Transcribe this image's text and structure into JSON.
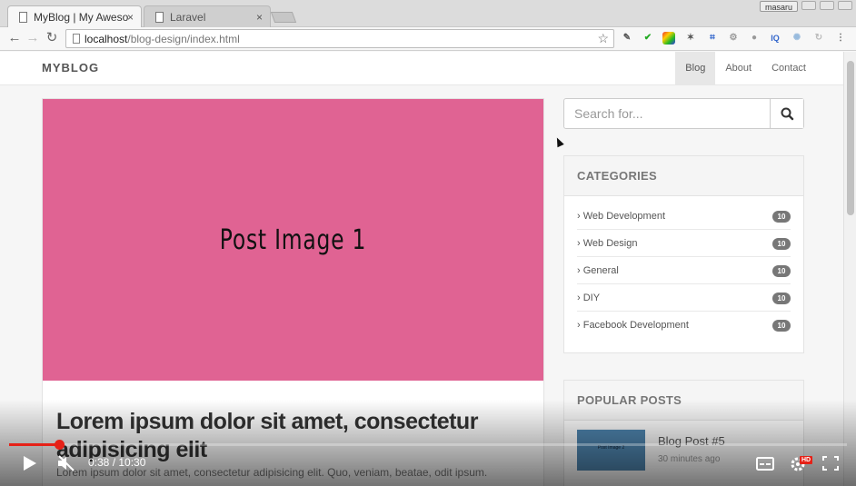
{
  "browser": {
    "tabs": [
      {
        "title": "MyBlog | My Aweso",
        "close": "×"
      },
      {
        "title": "Laravel",
        "close": "×"
      }
    ],
    "user_badge": "masaru",
    "omnibox": {
      "host": "localhost",
      "path": "/blog-design/index.html"
    },
    "nav": {
      "back": "←",
      "forward": "→",
      "reload": "↻"
    },
    "extension_icons": [
      "eyedropper-icon",
      "check-icon",
      "palette-icon",
      "puzzle-icon",
      "bracket-icon",
      "gear-icon",
      "ring-icon",
      "iq-icon",
      "sun-icon",
      "sync-icon",
      "menu-icon"
    ]
  },
  "site": {
    "brand": "MYBLOG",
    "menu": [
      "Blog",
      "About",
      "Contact"
    ],
    "active_menu": "Blog"
  },
  "post": {
    "image_caption": "Post Image 1",
    "image_color": "#e06393",
    "title": "Lorem ipsum dolor sit amet, consectetur adipisicing elit",
    "excerpt": "Lorem ipsum dolor sit amet, consectetur adipisicing elit. Quo, veniam, beatae, odit ipsum."
  },
  "sidebar": {
    "search_placeholder": "Search for...",
    "categories_title": "CATEGORIES",
    "categories": [
      {
        "label": "› Web Development",
        "count": "10"
      },
      {
        "label": "› Web Design",
        "count": "10"
      },
      {
        "label": "› General",
        "count": "10"
      },
      {
        "label": "› DIY",
        "count": "10"
      },
      {
        "label": "› Facebook Development",
        "count": "10"
      }
    ],
    "popular_title": "POPULAR POSTS",
    "popular": [
      {
        "thumb_caption": "Post Image 2",
        "title": "Blog Post #5",
        "date": "30 minutes ago"
      }
    ]
  },
  "player": {
    "time": "0:38 / 10:30",
    "progress_fraction": 0.06,
    "accent": "#e62117",
    "hd_badge": "HD"
  }
}
